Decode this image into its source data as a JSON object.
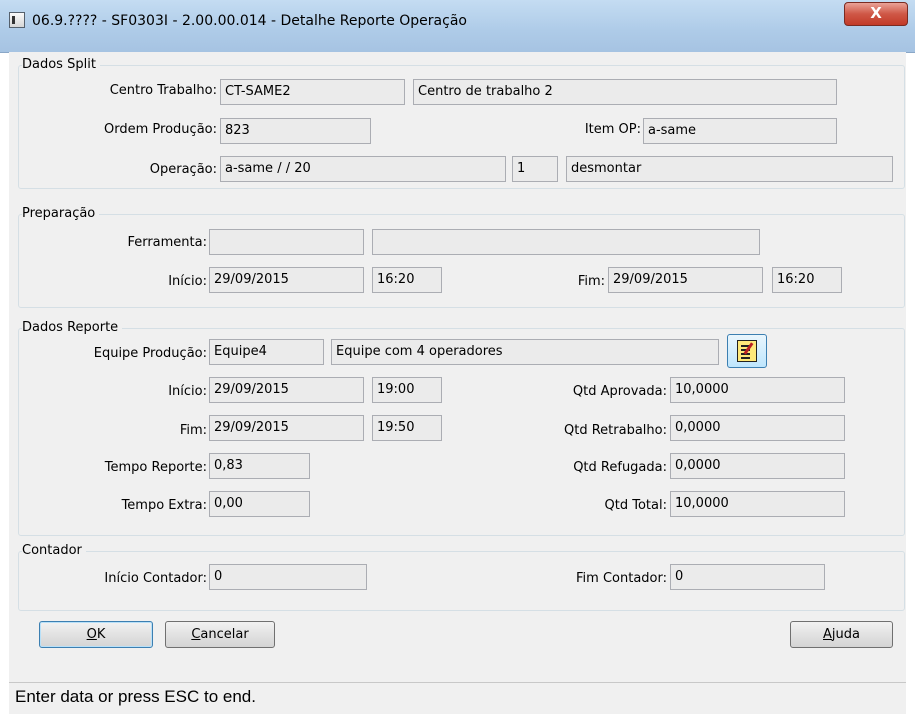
{
  "window": {
    "title": "06.9.???? - SF0303I - 2.00.00.014 - Detalhe Reporte Operação",
    "close_glyph": "X"
  },
  "dados_split": {
    "legend": "Dados Split",
    "centro_trabalho_label": "Centro Trabalho:",
    "centro_trabalho_code": "CT-SAME2",
    "centro_trabalho_desc": "Centro de trabalho 2",
    "ordem_producao_label": "Ordem Produção:",
    "ordem_producao_value": "823",
    "item_op_label": "Item OP:",
    "item_op_value": "a-same",
    "operacao_label": "Operação:",
    "operacao_value": "a-same / /    20",
    "operacao_seq": "1",
    "operacao_desc": "desmontar"
  },
  "preparacao": {
    "legend": "Preparação",
    "ferramenta_label": "Ferramenta:",
    "ferramenta_code": "",
    "ferramenta_desc": "",
    "inicio_label": "Início:",
    "inicio_date": "29/09/2015",
    "inicio_time": "16:20",
    "fim_label": "Fim:",
    "fim_date": "29/09/2015",
    "fim_time": "16:20"
  },
  "dados_reporte": {
    "legend": "Dados Reporte",
    "equipe_label": "Equipe Produção:",
    "equipe_code": "Equipe4",
    "equipe_desc": "Equipe com 4 operadores",
    "inicio_label": "Início:",
    "inicio_date": "29/09/2015",
    "inicio_time": "19:00",
    "fim_label": "Fim:",
    "fim_date": "29/09/2015",
    "fim_time": "19:50",
    "tempo_reporte_label": "Tempo Reporte:",
    "tempo_reporte_value": "0,83",
    "tempo_extra_label": "Tempo Extra:",
    "tempo_extra_value": "0,00",
    "qtd_aprovada_label": "Qtd  Aprovada:",
    "qtd_aprovada_value": "10,0000",
    "qtd_retrabalho_label": "Qtd Retrabalho:",
    "qtd_retrabalho_value": "0,0000",
    "qtd_refugada_label": "Qtd  Refugada:",
    "qtd_refugada_value": "0,0000",
    "qtd_total_label": "Qtd Total:",
    "qtd_total_value": "10,0000"
  },
  "contador": {
    "legend": "Contador",
    "inicio_label": "Início Contador:",
    "inicio_value": "0",
    "fim_label": "Fim Contador:",
    "fim_value": "0"
  },
  "buttons": {
    "ok_mnemonic": "O",
    "ok_rest": "K",
    "cancelar_mnemonic": "C",
    "cancelar_rest": "ancelar",
    "ajuda_mnemonic": "A",
    "ajuda_rest": "juda",
    "equipe_icon": "notepad-edit-icon"
  },
  "status": {
    "text": "Enter data or press ESC to end."
  }
}
